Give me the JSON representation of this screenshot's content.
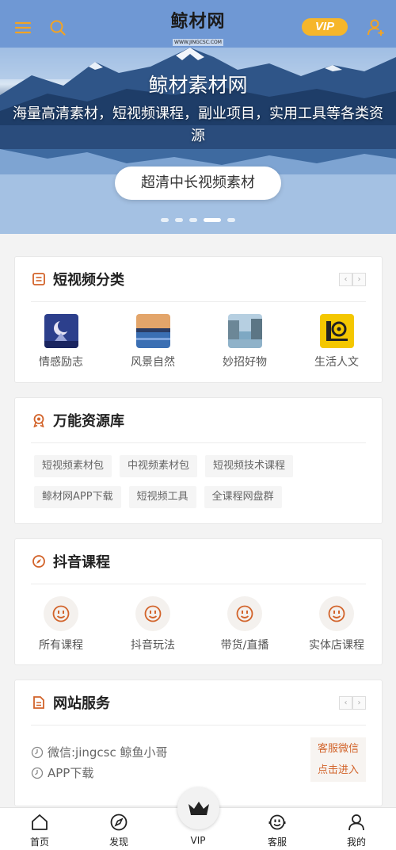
{
  "header": {
    "logo_name": "鲸材网",
    "logo_url": "WWW.JINGCSC.COM",
    "vip_label": "VIP",
    "menu_icon": "menu-icon",
    "search_icon": "search-icon",
    "user_icon": "user-add-icon"
  },
  "hero": {
    "title": "鲸材素材网",
    "subtitle": "海量高清素材，短视频课程，副业项目，实用工具等各类资源",
    "button_label": "超清中长视频素材",
    "slide_count": 5,
    "active_slide": 4
  },
  "short_video": {
    "title": "短视频分类",
    "icon": "list-icon",
    "items": [
      {
        "label": "情感励志"
      },
      {
        "label": "风景自然"
      },
      {
        "label": "妙招好物"
      },
      {
        "label": "生活人文"
      }
    ]
  },
  "resources": {
    "title": "万能资源库",
    "icon": "award-icon",
    "tags": [
      "短视频素材包",
      "中视频素材包",
      "短视频技术课程",
      "鲸材网APP下载",
      "短视频工具",
      "全课程网盘群"
    ]
  },
  "douyin": {
    "title": "抖音课程",
    "icon": "compass-icon",
    "items": [
      {
        "label": "所有课程"
      },
      {
        "label": "抖音玩法"
      },
      {
        "label": "带货/直播"
      },
      {
        "label": "实体店课程"
      }
    ]
  },
  "services": {
    "title": "网站服务",
    "icon": "document-icon",
    "rows": [
      {
        "label": "微信:jingcsc 鲸鱼小哥"
      },
      {
        "label": "APP下载"
      }
    ],
    "contact_line1": "客服微信",
    "contact_line2": "点击进入"
  },
  "bottom_nav": {
    "items": [
      {
        "label": "首页",
        "icon": "home-icon"
      },
      {
        "label": "发现",
        "icon": "compass-icon"
      },
      {
        "label": "VIP",
        "icon": "crown-icon"
      },
      {
        "label": "客服",
        "icon": "smile-icon"
      },
      {
        "label": "我的",
        "icon": "user-icon"
      }
    ]
  },
  "colors": {
    "accent": "#d2632a",
    "vip": "#f6b62a"
  }
}
